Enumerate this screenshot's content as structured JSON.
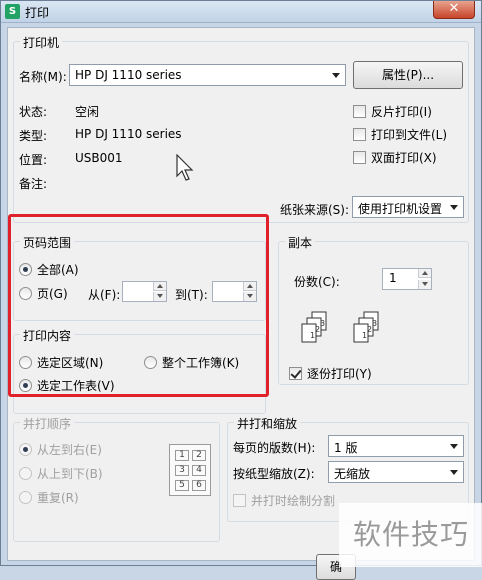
{
  "window": {
    "title": "打印",
    "app_icon_letter": "S",
    "close_glyph": "✕"
  },
  "printer": {
    "group_title": "打印机",
    "name_label": "名称(M):",
    "name_value": "HP DJ 1110 series",
    "properties_button": "属性(P)...",
    "status_label": "状态:",
    "status_value": "空闲",
    "type_label": "类型:",
    "type_value": "HP DJ 1110 series",
    "location_label": "位置:",
    "location_value": "USB001",
    "comment_label": "备注:",
    "reverse_print": "反片打印(I)",
    "print_to_file": "打印到文件(L)",
    "duplex": "双面打印(X)",
    "paper_source_label": "纸张来源(S):",
    "paper_source_value": "使用打印机设置"
  },
  "page_range": {
    "group_title": "页码范围",
    "all": "全部(A)",
    "pages": "页(G)",
    "from_label": "从(F):",
    "to_label": "到(T):"
  },
  "print_content": {
    "group_title": "打印内容",
    "selection": "选定区域(N)",
    "entire_workbook": "整个工作簿(K)",
    "selected_sheet": "选定工作表(V)"
  },
  "copies": {
    "group_title": "副本",
    "count_label": "份数(C):",
    "count_value": "1",
    "collate": "逐份打印(Y)",
    "collate_icon_pages": [
      "1",
      "2",
      "3"
    ]
  },
  "print_order": {
    "group_title": "并打顺序",
    "left_to_right": "从左到右(E)",
    "top_to_bottom": "从上到下(B)",
    "repeat": "重复(R)",
    "grid_numbers": [
      "1",
      "2",
      "3",
      "4",
      "5",
      "6"
    ]
  },
  "zoom": {
    "group_title": "并打和缩放",
    "pages_per_sheet_label": "每页的版数(H):",
    "pages_per_sheet_value": "1 版",
    "scale_to_paper_label": "按纸型缩放(Z):",
    "scale_to_paper_value": "无缩放",
    "draw_borders": "并打时绘制分割"
  },
  "ok_button_partial": "确",
  "watermark": "软件技巧",
  "colors": {
    "highlight": "#e0202a"
  }
}
